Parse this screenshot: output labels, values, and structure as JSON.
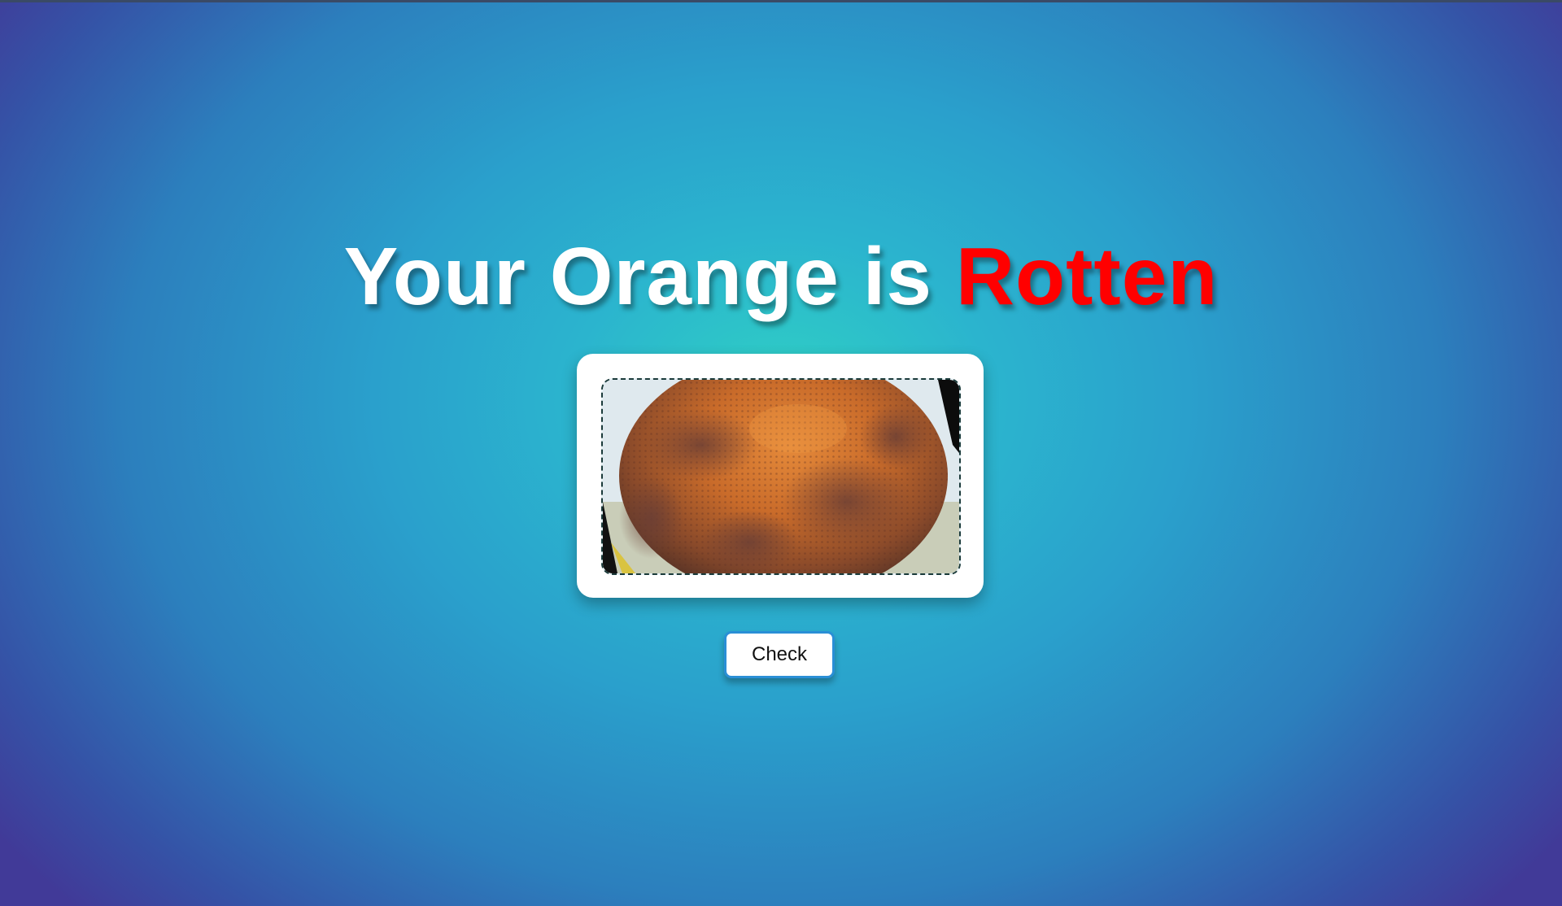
{
  "result": {
    "title_prefix": "Your Orange is",
    "verdict": "Rotten",
    "verdict_color": "#ff0000"
  },
  "image": {
    "subject": "rotten orange photo"
  },
  "actions": {
    "check_label": "Check"
  }
}
